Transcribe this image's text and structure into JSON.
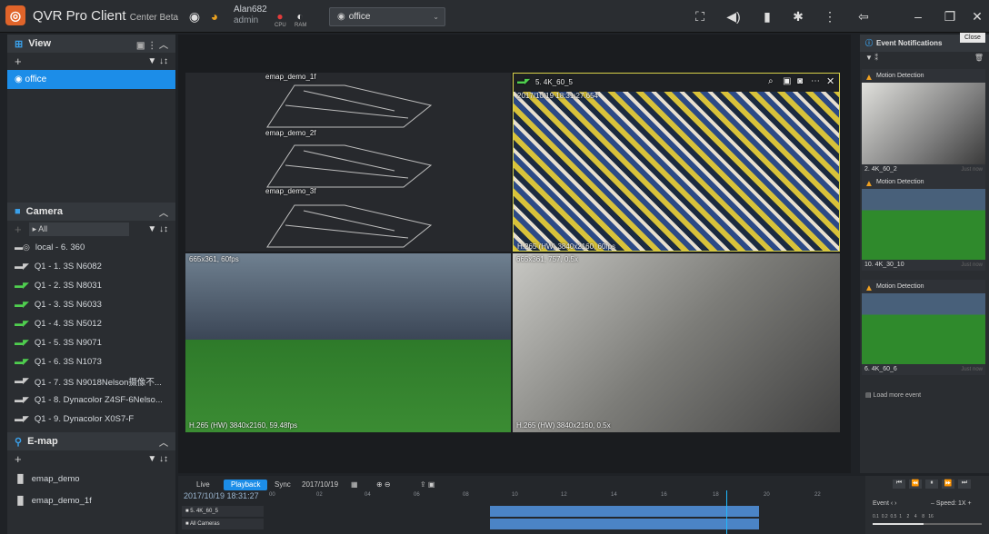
{
  "app": {
    "title": "QVR Pro Client",
    "subtitle": "Center Beta"
  },
  "user": {
    "name": "Alan682",
    "role": "admin"
  },
  "resources": {
    "cpu_label": "CPU",
    "ram_label": "RAM"
  },
  "view_selector": {
    "value": "office"
  },
  "close_tooltip": "Close",
  "sidebar": {
    "view_section": {
      "title": "View",
      "selected_view": "office"
    },
    "camera_section": {
      "title": "Camera",
      "filter": "All",
      "items": [
        {
          "label": "local - 6. 360"
        },
        {
          "label": "Q1 - 1. 3S N6082"
        },
        {
          "label": "Q1 - 2. 3S N8031"
        },
        {
          "label": "Q1 - 3. 3S N6033"
        },
        {
          "label": "Q1 - 4. 3S N5012"
        },
        {
          "label": "Q1 - 5. 3S N9071"
        },
        {
          "label": "Q1 - 6. 3S N1073"
        },
        {
          "label": "Q1 - 7. 3S N9018Nelson摄像不..."
        },
        {
          "label": "Q1 - 8. Dynacolor Z4SF-6Nelso..."
        },
        {
          "label": "Q1 - 9. Dynacolor X0S7-F"
        }
      ]
    },
    "emap_section": {
      "title": "E-map",
      "items": [
        {
          "label": "emap_demo"
        },
        {
          "label": "emap_demo_1f"
        }
      ]
    }
  },
  "tiles": {
    "emap": {
      "floors": [
        "emap_demo_1f",
        "emap_demo_2f",
        "emap_demo_3f"
      ]
    },
    "cam_top_right": {
      "name": "5. 4K_60_5",
      "timestamp": "2017/10/19 18:31:27.654",
      "info": "H.265 (HW) 3840x2160, 60fps"
    },
    "cam_bottom_left": {
      "info_top": "665x361, 60fps",
      "info_bottom": "H.265 (HW) 3840x2160, 59.48fps"
    },
    "cam_bottom_right": {
      "info_top": "665x361, 757, 0.5x",
      "info_bottom": "H.265 (HW) 3840x2160, 0.5x"
    }
  },
  "event_panel": {
    "title": "Event Notifications",
    "events": [
      {
        "type": "Motion Detection",
        "camera": "2. 4K_60_2",
        "ago": "Just now"
      },
      {
        "type": "Motion Detection",
        "camera": "10. 4K_30_10",
        "ago": "Just now"
      },
      {
        "type": "Motion Detection",
        "camera": "6. 4K_60_6",
        "ago": "Just now"
      }
    ],
    "load_more": "Load more event"
  },
  "timeline": {
    "tabs": [
      "Live",
      "Playback",
      "Sync"
    ],
    "active_tab": "Playback",
    "date": "2017/10/19",
    "current_time": "2017/10/19 18:31:27",
    "ticks": [
      "00",
      "02",
      "04",
      "06",
      "08",
      "10",
      "12",
      "14",
      "16",
      "18",
      "20",
      "22"
    ],
    "tracks": [
      {
        "label": "5. 4K_60_5"
      },
      {
        "label": "All Cameras"
      }
    ],
    "event_label": "Event",
    "speed_label": "Speed: 1X",
    "speed_values": [
      "0.1",
      "0.2",
      "0.5",
      "1",
      "2",
      "4",
      "8",
      "16"
    ]
  },
  "colors": {
    "accent": "#1c8de8",
    "brand": "#e0642a",
    "warning": "#f0a020",
    "selected_border": "#d8d24a"
  }
}
